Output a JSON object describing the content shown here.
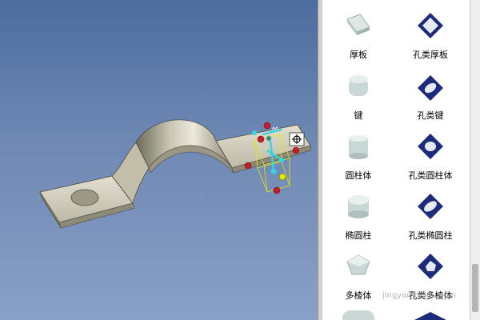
{
  "catalog": {
    "items": [
      {
        "label": "厚板",
        "icon": "slab-icon"
      },
      {
        "label": "孔类厚板",
        "icon": "hole-slab-icon"
      },
      {
        "label": "键",
        "icon": "key-icon"
      },
      {
        "label": "孔类键",
        "icon": "hole-key-icon"
      },
      {
        "label": "圆柱体",
        "icon": "cylinder-icon"
      },
      {
        "label": "孔类圆柱体",
        "icon": "hole-cylinder-icon"
      },
      {
        "label": "椭圆柱",
        "icon": "elliptic-cylinder-icon"
      },
      {
        "label": "孔类椭圆柱",
        "icon": "hole-elliptic-cylinder-icon"
      },
      {
        "label": "多棱体",
        "icon": "polyhedron-icon"
      },
      {
        "label": "孔类多棱体",
        "icon": "hole-polyhedron-icon"
      }
    ]
  },
  "watermark": "jingyan.baidu.com",
  "colors": {
    "viewport_top": "#4c6d9f",
    "viewport_bottom": "#8aa0c6",
    "part_face": "#d8d4c4",
    "hole_icon_fill": "#1e2a7a",
    "handle_red": "#c0202a",
    "handle_cyan": "#31d6e0",
    "handle_yellow": "#e8e800"
  }
}
